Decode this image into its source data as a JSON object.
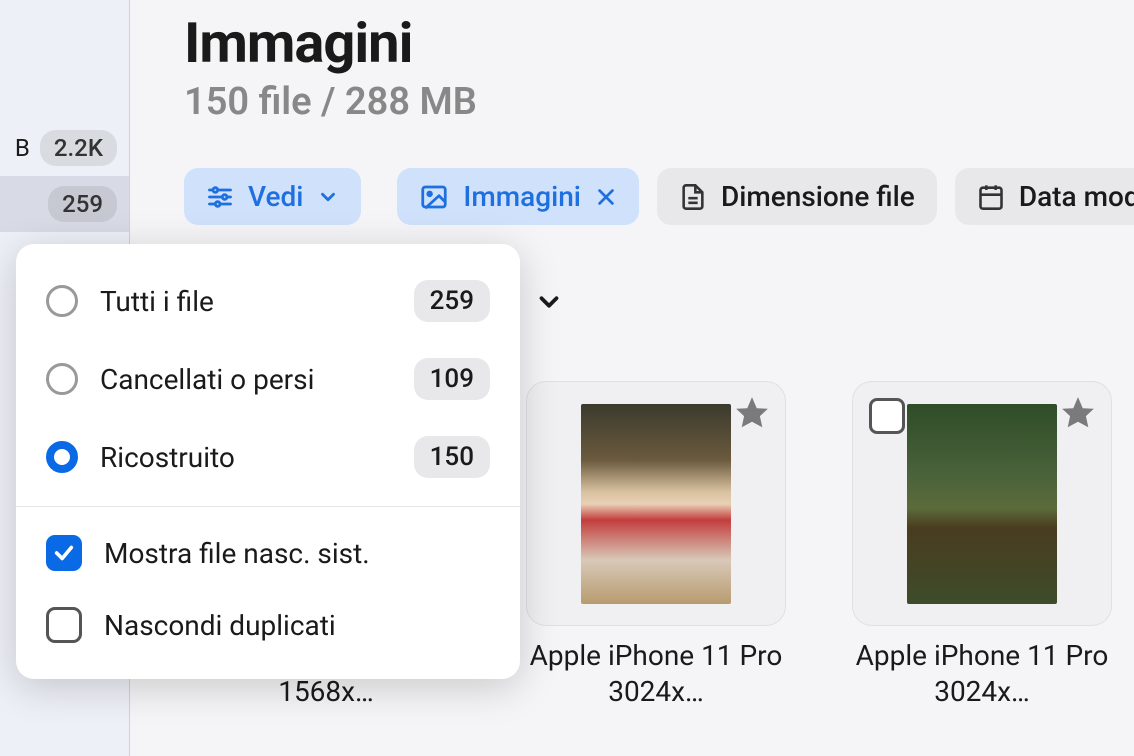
{
  "sidebar": {
    "items": [
      {
        "label": "B",
        "count": "2.2K"
      },
      {
        "label": "",
        "count": "259"
      }
    ]
  },
  "header": {
    "title": "Immagini",
    "subtitle": "150 file / 288 MB"
  },
  "filters": {
    "view_label": "Vedi",
    "images_label": "Immagini",
    "filesize_label": "Dimensione file",
    "datemod_label": "Data modi"
  },
  "dropdown": {
    "items": [
      {
        "label": "Tutti i file",
        "count": "259"
      },
      {
        "label": "Cancellati o persi",
        "count": "109"
      },
      {
        "label": "Ricostruito",
        "count": "150"
      }
    ],
    "show_hidden": "Mostra file nasc. sist.",
    "hide_dupes": "Nascondi duplicati"
  },
  "cards": [
    {
      "title": "Apple iPhone 11 Pro 1568x…"
    },
    {
      "title": "Apple iPhone 11 Pro 3024x…"
    },
    {
      "title": "Apple iPhone 11 Pro 3024x…"
    }
  ]
}
